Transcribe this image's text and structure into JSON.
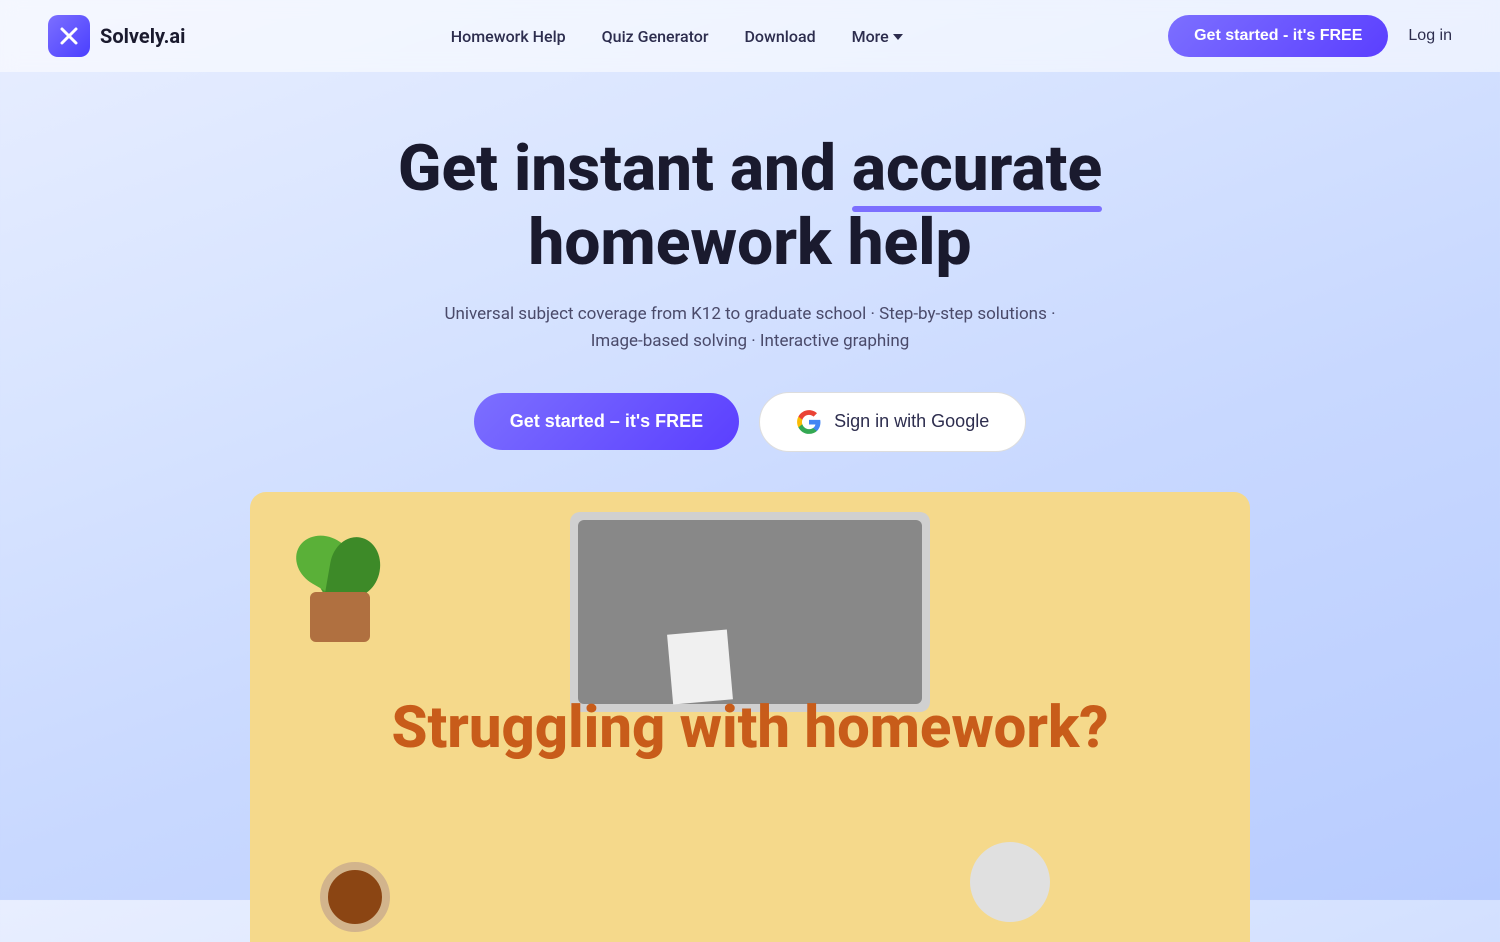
{
  "brand": {
    "name": "Solvely.ai",
    "logo_symbol": "✕"
  },
  "nav": {
    "links": [
      {
        "id": "homework-help",
        "label": "Homework Help"
      },
      {
        "id": "quiz-generator",
        "label": "Quiz Generator"
      },
      {
        "id": "download",
        "label": "Download"
      },
      {
        "id": "more",
        "label": "More"
      }
    ],
    "cta_label": "Get started - it's FREE",
    "login_label": "Log in"
  },
  "hero": {
    "title_part1": "Get instant and ",
    "title_accent": "accurate",
    "title_part2": "homework help",
    "subtitle_line1": "Universal subject coverage from K12 to graduate school · Step-by-step solutions ·",
    "subtitle_line2": "Image-based solving · Interactive graphing",
    "cta_primary": "Get started – it's FREE",
    "cta_google": "Sign in with Google"
  },
  "hero_image": {
    "struggling_text": "Struggling with homework?"
  }
}
